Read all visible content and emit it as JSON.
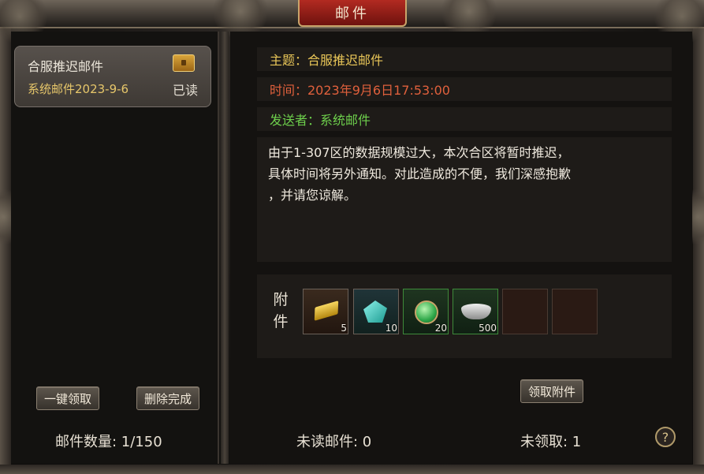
{
  "window": {
    "title": "邮件"
  },
  "mail_list": {
    "items": [
      {
        "title": "合服推迟邮件",
        "sender_date": "系统邮件2023-9-6",
        "status": "已读",
        "icon": "treasure-chest-icon"
      }
    ],
    "claim_all_label": "一键领取",
    "delete_done_label": "删除完成",
    "mail_count": "邮件数量: 1/150"
  },
  "mail_detail": {
    "subject": "主题：合服推迟邮件",
    "time": "时间：2023年9月6日17:53:00",
    "sender": "发送者：系统邮件",
    "body": "由于1-307区的数据规模过大，本次合区将暂时推迟，\n具体时间将另外通知。对此造成的不便，我们深感抱歉\n，并请您谅解。",
    "attachments_label": "附件",
    "attachments": [
      {
        "icon": "gold-bar-icon",
        "count": "5"
      },
      {
        "icon": "crystal-icon",
        "count": "10"
      },
      {
        "icon": "green-potion-icon",
        "count": "20"
      },
      {
        "icon": "silver-ingot-icon",
        "count": "500"
      }
    ],
    "claim_attach_label": "领取附件"
  },
  "footer": {
    "unread": "未读邮件: 0",
    "unclaimed": "未领取: 1",
    "help_glyph": "?"
  },
  "colors": {
    "subject": "#e9c658",
    "time": "#e0603c",
    "sender": "#6ed04c",
    "title_tab": "#b22a21"
  }
}
